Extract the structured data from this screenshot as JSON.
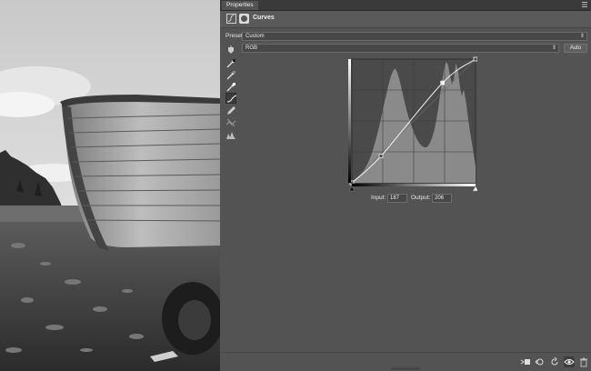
{
  "panel": {
    "tab_label": "Properties",
    "title": "Curves",
    "preset_label": "Preset:",
    "preset_value": "Custom",
    "channel_value": "RGB",
    "auto_label": "Auto",
    "input_label": "Input:",
    "input_value": "187",
    "output_label": "Output:",
    "output_value": "206"
  },
  "tools": [
    "on-image-adjust-icon",
    "black-point-eyedropper-icon",
    "gray-point-eyedropper-icon",
    "white-point-eyedropper-icon",
    "curve-point-icon",
    "pencil-icon",
    "smooth-curve-icon",
    "clipping-warning-icon"
  ],
  "bottom_icons": [
    "clip-to-layer-icon",
    "view-previous-icon",
    "reset-icon",
    "visibility-icon",
    "trash-icon"
  ],
  "curve": {
    "points": [
      [
        0,
        0
      ],
      [
        60,
        55
      ],
      [
        187,
        206
      ],
      [
        255,
        255
      ]
    ],
    "selected_point": 2
  },
  "histogram": [
    2,
    3,
    4,
    6,
    8,
    11,
    14,
    18,
    22,
    27,
    33,
    40,
    48,
    57,
    66,
    76,
    87,
    97,
    107,
    116,
    124,
    129,
    132,
    128,
    121,
    112,
    102,
    92,
    83,
    75,
    68,
    62,
    56,
    51,
    47,
    44,
    42,
    41,
    41,
    43,
    47,
    53,
    61,
    72,
    86,
    102,
    118,
    132,
    140,
    136,
    124,
    114,
    120,
    138,
    130,
    112,
    100,
    108,
    96,
    78,
    62,
    48,
    34,
    20
  ],
  "colors": {
    "panel_bg": "#535353",
    "graph_bg": "#4a4a4a",
    "histogram_fill": "#8a8a8a",
    "curve_line": "#f0f0f0"
  }
}
